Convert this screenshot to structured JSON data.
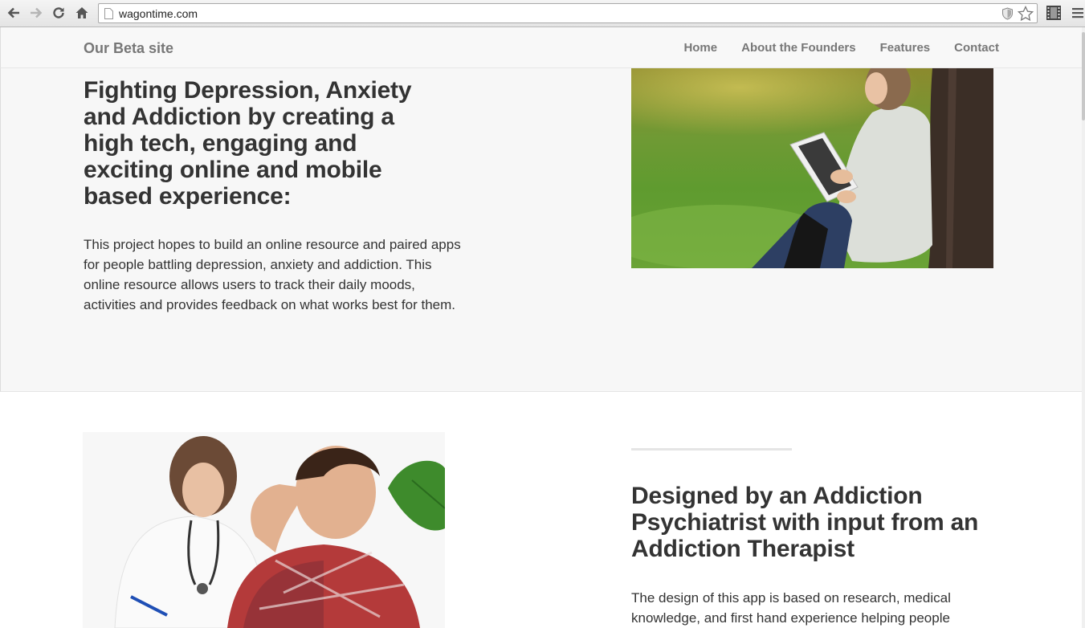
{
  "browser": {
    "url": "wagontime.com",
    "icons": [
      "back-icon",
      "forward-icon",
      "reload-icon",
      "home-icon",
      "page-icon",
      "shield-icon",
      "star-icon",
      "film-icon",
      "menu-icon"
    ]
  },
  "nav": {
    "brand": "Our Beta site",
    "links": [
      "Home",
      "About the Founders",
      "Features",
      "Contact"
    ]
  },
  "hero": {
    "heading": "Fighting Depression, Anxiety and Addiction by creating a high tech, engaging and exciting online and mobile based experience:",
    "body": "This project hopes to build an online resource and paired apps for people battling depression, anxiety and addiction. This online resource allows users to track their daily moods, activities and provides feedback on what works best for them."
  },
  "feature": {
    "heading": "Designed by an Addiction Psychiatrist with input from an Addiction Therapist",
    "body": "The design of this app is based on research, medical knowledge, and first hand experience helping people"
  }
}
